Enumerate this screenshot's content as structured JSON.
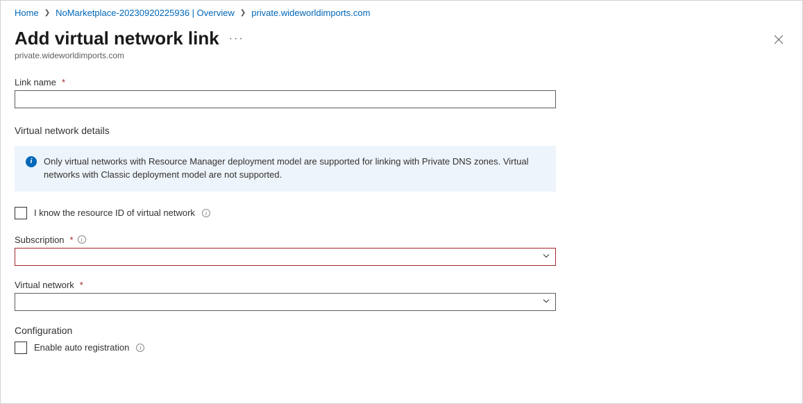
{
  "breadcrumb": {
    "home": "Home",
    "middle": "NoMarketplace-20230920225936 | Overview",
    "current": "private.wideworldimports.com"
  },
  "header": {
    "title": "Add virtual network link",
    "subtitle": "private.wideworldimports.com"
  },
  "form": {
    "link_name_label": "Link name",
    "link_name_value": "",
    "vnet_details_heading": "Virtual network details",
    "info_banner_text": "Only virtual networks with Resource Manager deployment model are supported for linking with Private DNS zones. Virtual networks with Classic deployment model are not supported.",
    "know_resource_id_label": "I know the resource ID of virtual network",
    "know_resource_id_checked": false,
    "subscription_label": "Subscription",
    "subscription_value": "",
    "vnet_label": "Virtual network",
    "vnet_value": "",
    "configuration_heading": "Configuration",
    "enable_auto_reg_label": "Enable auto registration",
    "enable_auto_reg_checked": false
  }
}
